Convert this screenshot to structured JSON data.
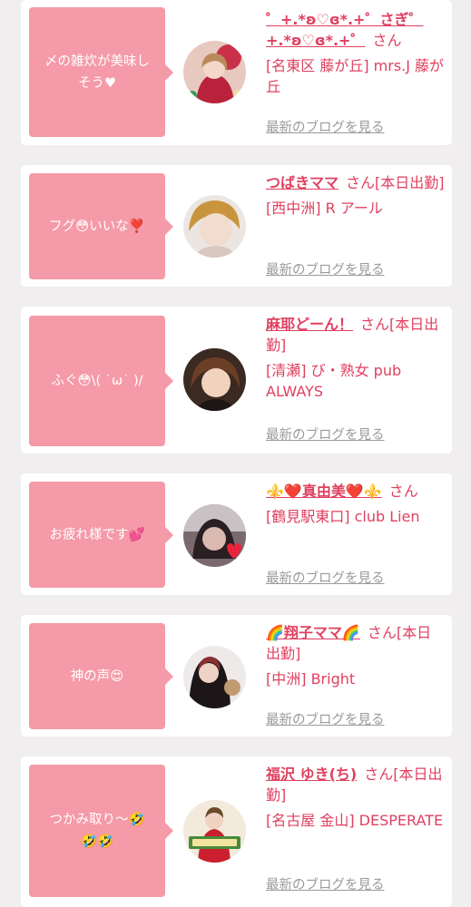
{
  "blog_link_label": "最新のブログを見る",
  "entries": [
    {
      "message": "〆の雑炊が美味し\nそう♥",
      "name": "゜+.*ʚ♡ɞ*.+゜さぎ゜+.*ʚ♡ɞ*.+゜",
      "suffix": "さん",
      "store": "[名東区 藤が丘] mrs.J 藤が丘"
    },
    {
      "message": "フグ😳いいな❣️",
      "name": "つばきママ",
      "suffix": "さん[本日出勤]",
      "store": "[西中洲] R アール"
    },
    {
      "message": "ふぐ😳\\( ˙ω˙ )/",
      "name": "麻耶どーん！",
      "suffix": "さん[本日出勤]",
      "store": "[清瀬] び・熟女 pub ALWAYS"
    },
    {
      "message": "お疲れ様です💕",
      "name": "⚜️❤️真由美❤️⚜️",
      "suffix": "さん",
      "store": "[鶴見駅東口] club Lien"
    },
    {
      "message": "神の声😍",
      "name": "🌈翔子ママ🌈",
      "suffix": "さん[本日出勤]",
      "store": "[中洲] Bright"
    },
    {
      "message": "つかみ取り〜🤣\n🤣🤣",
      "name": "福沢 ゆき(ち)",
      "suffix": "さん[本日出勤]",
      "store": "[名古屋 金山] DESPERATE"
    }
  ]
}
